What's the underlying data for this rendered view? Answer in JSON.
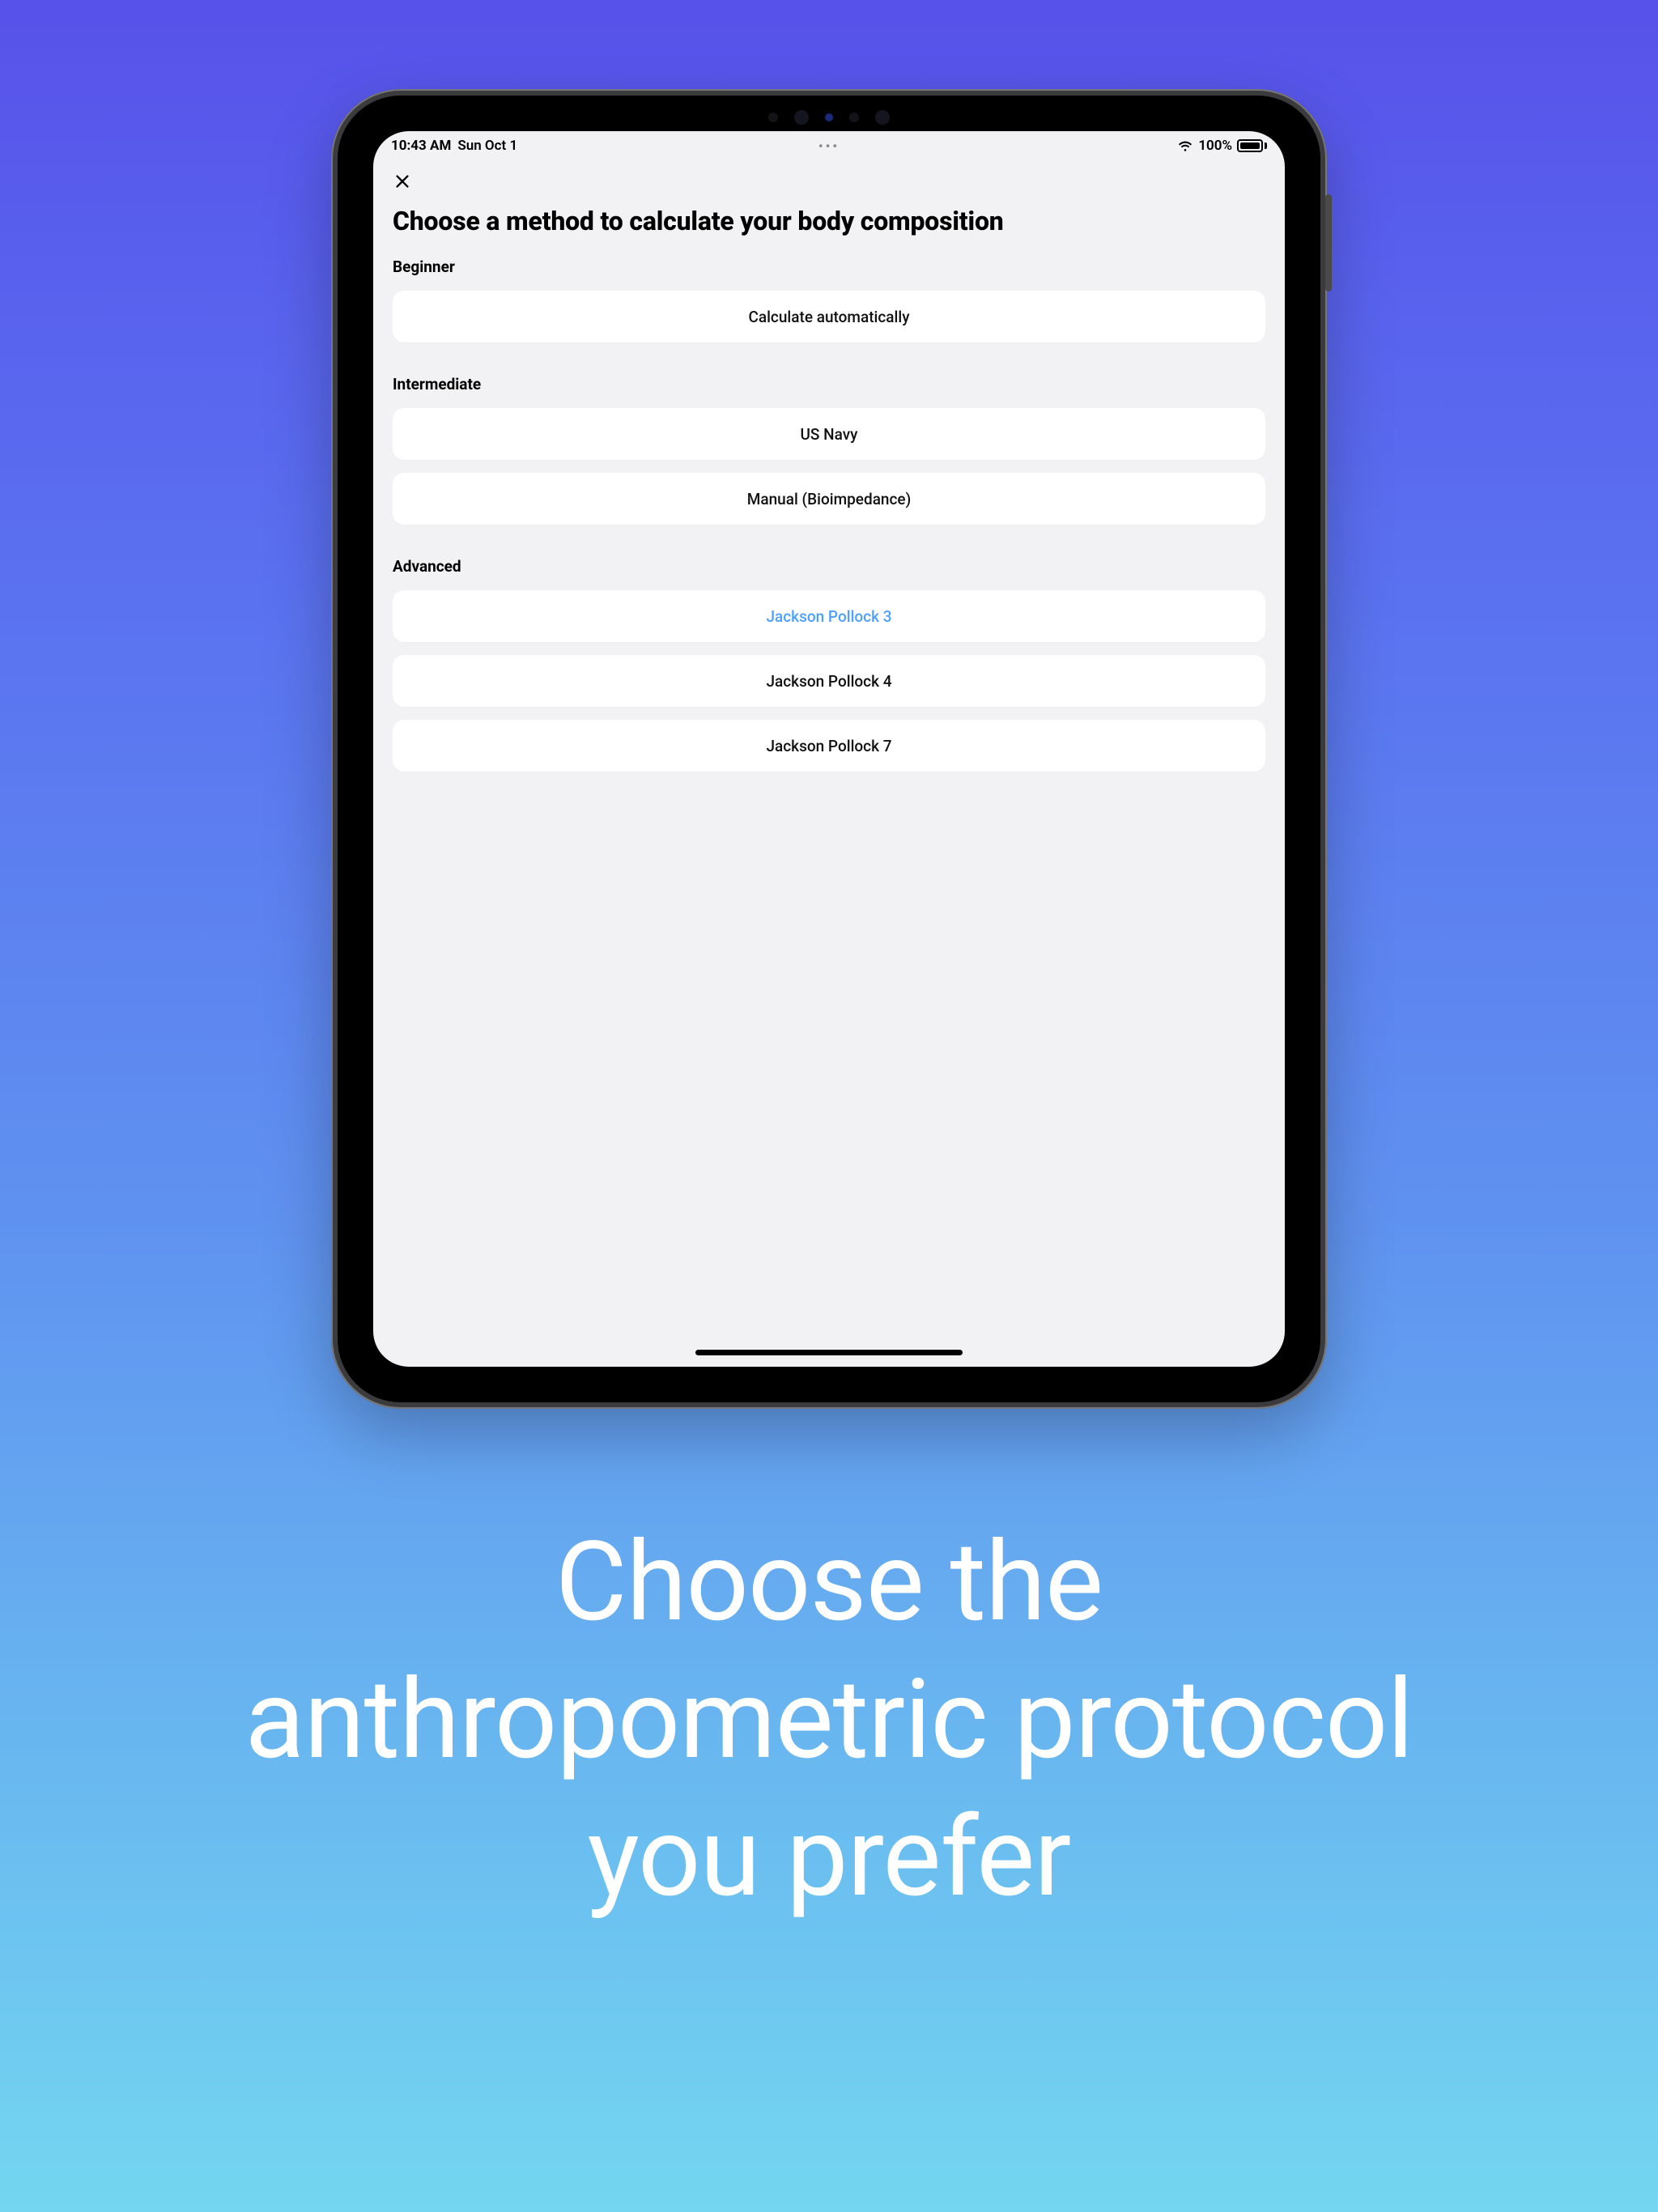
{
  "status": {
    "time": "10:43 AM",
    "date": "Sun Oct 1",
    "multitask_dots": "•••",
    "battery_pct": "100%"
  },
  "page": {
    "title": "Choose a method to calculate your body composition"
  },
  "sections": {
    "beginner": {
      "label": "Beginner",
      "items": {
        "auto": "Calculate automatically"
      }
    },
    "intermediate": {
      "label": "Intermediate",
      "items": {
        "us_navy": "US Navy",
        "manual_bio": "Manual (Bioimpedance)"
      }
    },
    "advanced": {
      "label": "Advanced",
      "items": {
        "jp3": "Jackson Pollock 3",
        "jp4": "Jackson Pollock 4",
        "jp7": "Jackson Pollock 7"
      }
    }
  },
  "caption": {
    "line1": "Choose the",
    "line2": "anthropometric protocol",
    "line3": "you prefer"
  }
}
